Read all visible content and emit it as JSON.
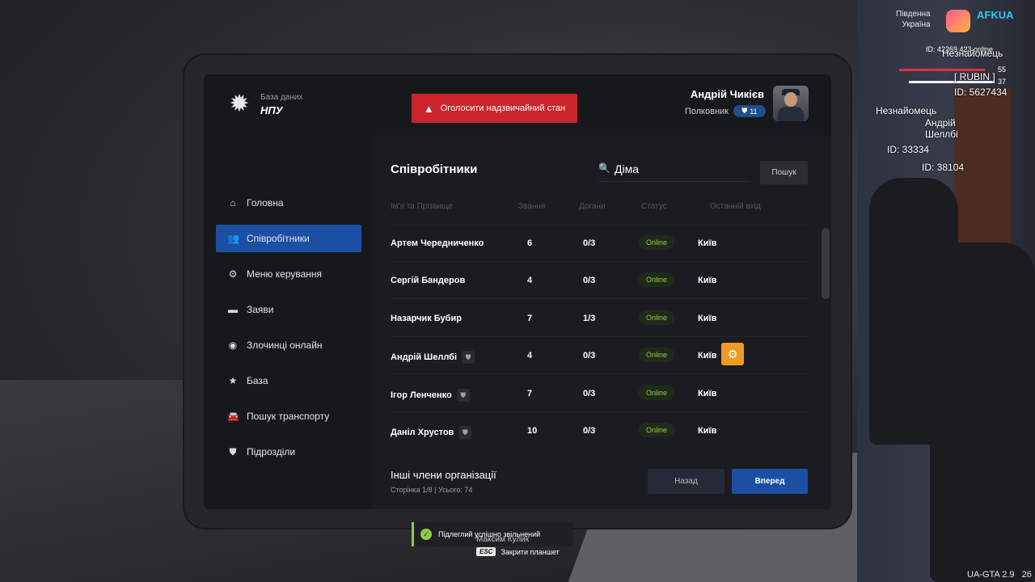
{
  "header": {
    "logo_small": "База даних",
    "logo_big": "НПУ",
    "emergency_button": "Оголосити надзвичайний стан",
    "user_name": "Андрій Чикієв",
    "user_rank": "Полковник",
    "rank_level": "11"
  },
  "sidebar": {
    "items": [
      {
        "label": "Головна",
        "icon": "home-icon"
      },
      {
        "label": "Співробітники",
        "icon": "users-icon",
        "active": true
      },
      {
        "label": "Меню керування",
        "icon": "gear-icon"
      },
      {
        "label": "Заяви",
        "icon": "folder-icon"
      },
      {
        "label": "Злочинці онлайн",
        "icon": "criminal-icon"
      },
      {
        "label": "База",
        "icon": "star-icon"
      },
      {
        "label": "Пошук транспорту",
        "icon": "car-icon"
      },
      {
        "label": "Підрозділи",
        "icon": "shield-icon"
      }
    ]
  },
  "main": {
    "title": "Співробітники",
    "search_value": "Діма",
    "search_button": "Пошук",
    "columns": [
      "Ім'я та Прізвище",
      "Звання",
      "Догани",
      "Статус",
      "Останній вхід"
    ],
    "rows": [
      {
        "name": "Артем Чередниченко",
        "rank": "6",
        "reprimands": "0/3",
        "status": "Online",
        "last_login": "Київ",
        "shield": false,
        "gear": false
      },
      {
        "name": "Сергій Бандеров",
        "rank": "4",
        "reprimands": "0/3",
        "status": "Online",
        "last_login": "Київ",
        "shield": false,
        "gear": false
      },
      {
        "name": "Назарчик Бубир",
        "rank": "7",
        "reprimands": "1/3",
        "status": "Online",
        "last_login": "Київ",
        "shield": false,
        "gear": false
      },
      {
        "name": "Андрій Шеллбі",
        "rank": "4",
        "reprimands": "0/3",
        "status": "Online",
        "last_login": "Київ",
        "shield": true,
        "gear": true
      },
      {
        "name": "Ігор Ленченко",
        "rank": "7",
        "reprimands": "0/3",
        "status": "Online",
        "last_login": "Київ",
        "shield": true,
        "gear": false
      },
      {
        "name": "Даніл Хрустов",
        "rank": "10",
        "reprimands": "0/3",
        "status": "Online",
        "last_login": "Київ",
        "shield": true,
        "gear": false
      }
    ],
    "footer_title": "Інші члени організації",
    "footer_sub": "Сторінка 1/8 | Усього: 74",
    "prev_button": "Назад",
    "next_button": "Вперед"
  },
  "hud": {
    "server_line1": "Південна",
    "server_line2": "Україна",
    "logo_text": "AFKUA",
    "id_online": "ID: 42269  423 online",
    "player_label": "Незнайомець",
    "hp_value": "55",
    "armor_value": "37",
    "tag": "[ RUBIN ]",
    "tag_id": "ID: 5627434",
    "nearby1": "Незнайомець",
    "nearby2_line1": "Андрій",
    "nearby2_line2": "Шеллбі",
    "nearby_id1": "ID: 33334",
    "nearby_id2": "ID: 38104",
    "version": "UA-GTA 2.9",
    "fps": "26"
  },
  "notification": {
    "text": "Підлеглий успішно звільнений",
    "sub_name": "Максим Кулик",
    "esc_key": "ESC",
    "esc_text": "Закрити планшет"
  },
  "colors": {
    "accent": "#1b4fa3",
    "danger": "#c9252b",
    "online": "#8fcc47",
    "gear": "#f09a24"
  }
}
